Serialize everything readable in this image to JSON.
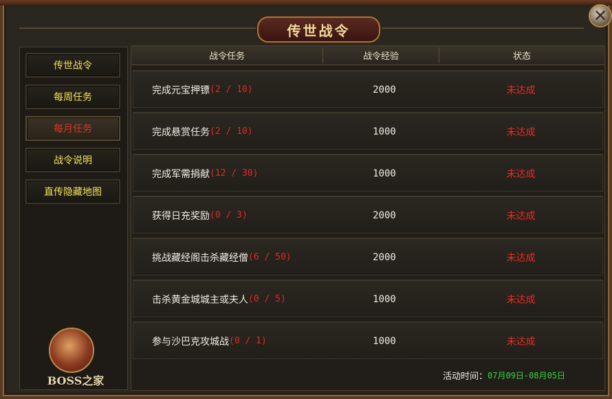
{
  "window": {
    "title": "传世战令",
    "close_icon": "close-icon"
  },
  "sidebar": {
    "items": [
      {
        "label": "传世战令",
        "active": false
      },
      {
        "label": "每周任务",
        "active": false
      },
      {
        "label": "每月任务",
        "active": true
      },
      {
        "label": "战令说明",
        "active": false
      },
      {
        "label": "直传隐藏地图",
        "active": false
      }
    ],
    "logo_text": "BOSS之家"
  },
  "table": {
    "headers": [
      "战令任务",
      "战令经验",
      "状态"
    ],
    "rows": [
      {
        "task": "完成元宝押镖",
        "progress": "(2 / 10)",
        "exp": "2000",
        "status": "未达成"
      },
      {
        "task": "完成悬赏任务",
        "progress": "(2 / 10)",
        "exp": "1000",
        "status": "未达成"
      },
      {
        "task": "完成军需捐献",
        "progress": "(12 / 30)",
        "exp": "1000",
        "status": "未达成"
      },
      {
        "task": "获得日充奖励",
        "progress": "(0 / 3)",
        "exp": "2000",
        "status": "未达成"
      },
      {
        "task": "挑战藏经阁击杀藏经僧",
        "progress": "(6 / 50)",
        "exp": "2000",
        "status": "未达成"
      },
      {
        "task": "击杀黄金城城主或夫人",
        "progress": "(0 / 5)",
        "exp": "1000",
        "status": "未达成"
      },
      {
        "task": "参与沙巴克攻城战",
        "progress": "(0 / 1)",
        "exp": "1000",
        "status": "未达成"
      }
    ]
  },
  "activity": {
    "label": "活动时间：",
    "value": "07月09日-08月05日"
  },
  "colors": {
    "active_tab": "#e2342a",
    "tab_text": "#f4e35a",
    "status_fail": "#ee2a22",
    "progress": "#e02a22",
    "activity_value": "#34d43a"
  }
}
